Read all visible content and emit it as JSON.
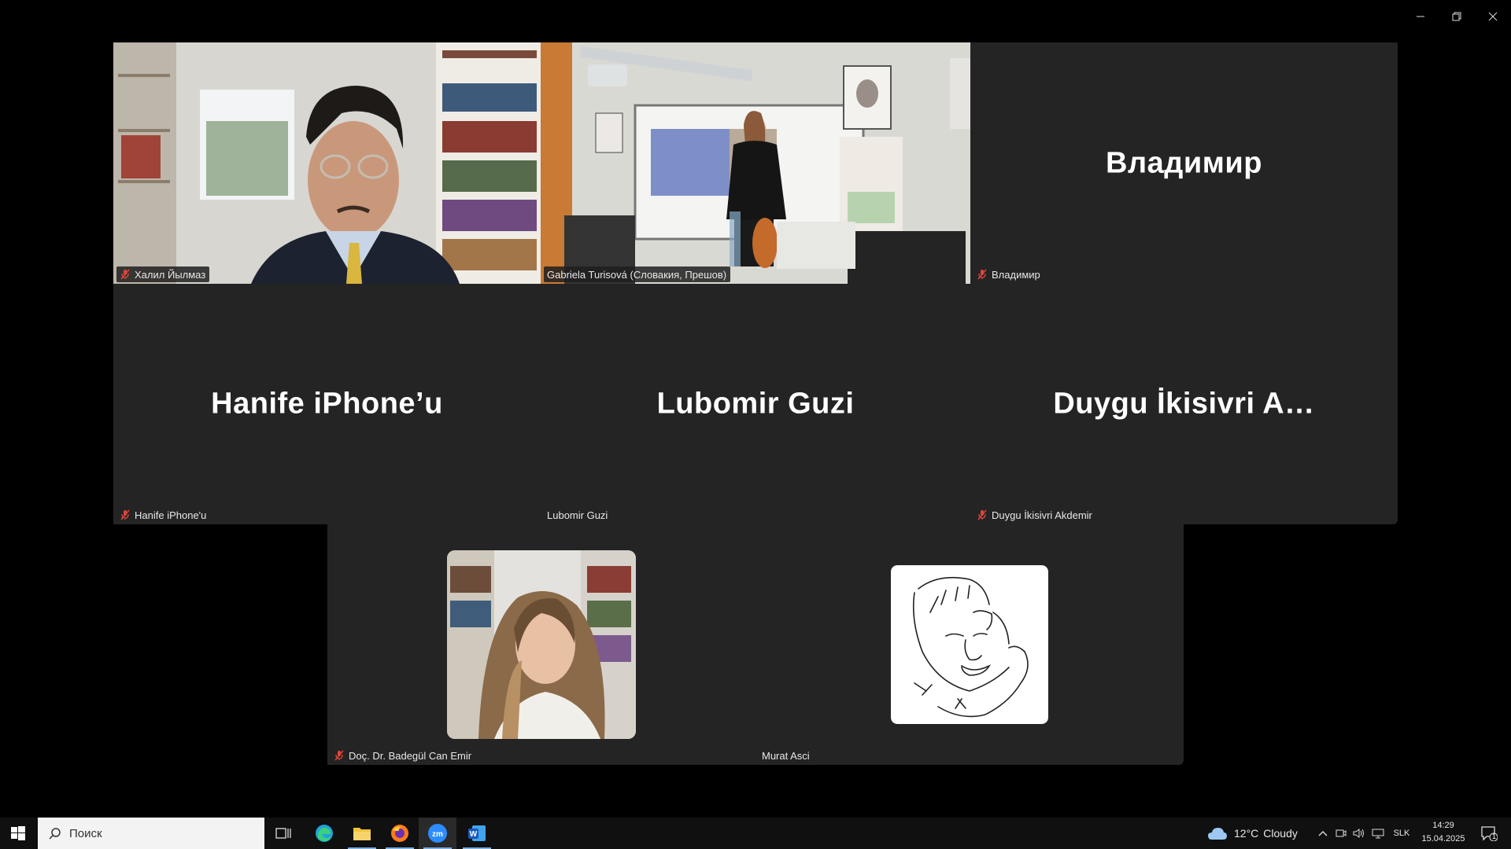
{
  "window": {
    "controls": [
      "minimize",
      "restore",
      "close"
    ]
  },
  "participants": {
    "p1": {
      "label": "Халил Йылмаз",
      "muted": true
    },
    "p2": {
      "label": "Gabriela Turisová (Словакия, Прешов)",
      "muted": false,
      "active_speaker": true
    },
    "p3": {
      "label": "Владимир",
      "big_name": "Владимир",
      "muted": true
    },
    "p4": {
      "label": "Hanife iPhone'u",
      "big_name": "Hanife iPhone’u",
      "muted": true
    },
    "p5": {
      "label": "Lubomir Guzi",
      "big_name": "Lubomir Guzi",
      "muted": false
    },
    "p6": {
      "label": "Duygu İkisivri Akdemir",
      "big_name": "Duygu İkisivri A…",
      "muted": true
    },
    "p7": {
      "label": "Doç. Dr. Badegül Can Emir",
      "muted": true
    },
    "p8": {
      "label": "Murat Asci",
      "muted": false
    }
  },
  "colors": {
    "active_speaker_border": "#2bd36e",
    "mute": "#e0453a",
    "tile_bg": "#242424"
  },
  "taskbar": {
    "search_placeholder": "Поиск",
    "apps": [
      "task-view",
      "edge",
      "file-explorer",
      "firefox",
      "zoom",
      "word"
    ],
    "weather": {
      "temp": "12°C",
      "condition": "Cloudy"
    },
    "language": "SLK",
    "time": "14:29",
    "date": "15.04.2025",
    "notifications": "1"
  }
}
